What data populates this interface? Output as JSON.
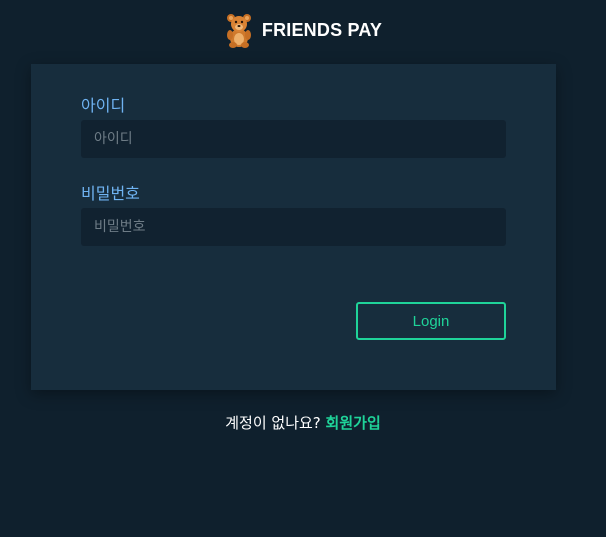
{
  "brand": {
    "icon": "teddy-bear-icon",
    "name": "FRIENDS PAY"
  },
  "form": {
    "id_label": "아이디",
    "id_placeholder": "아이디",
    "id_value": "",
    "password_label": "비밀번호",
    "password_placeholder": "비밀번호",
    "password_value": "",
    "login_label": "Login"
  },
  "signup": {
    "prompt": "계정이 없나요?",
    "link_label": "회원가입"
  },
  "colors": {
    "page_background": "#0f202d",
    "card_background": "#172d3d",
    "input_background": "#112230",
    "label_blue": "#6fb3f2",
    "accent_green": "#1fd399"
  }
}
